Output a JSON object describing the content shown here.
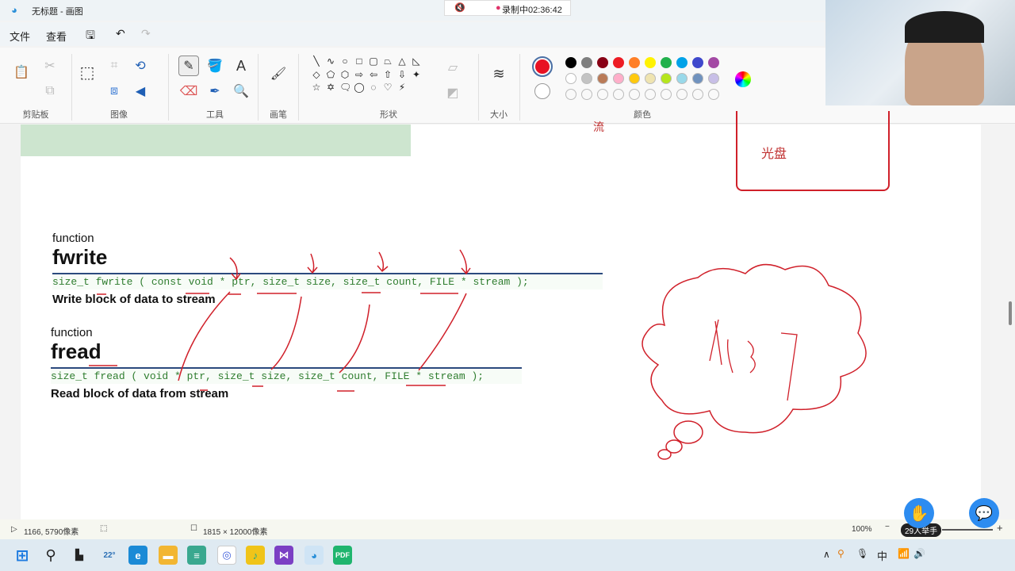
{
  "window": {
    "title": "无标题 - 画图"
  },
  "recording": {
    "label": "录制中02:36:42",
    "mute_icon": "speaker-muted-icon"
  },
  "menu": {
    "file": "文件",
    "view": "查看"
  },
  "ribbon": {
    "groups": [
      "剪贴板",
      "图像",
      "工具",
      "画笔",
      "形状",
      "大小",
      "颜色"
    ],
    "shapes": [
      "╲",
      "∿",
      "○",
      "□",
      "▢",
      "⏢",
      "△",
      "◺",
      "◇",
      "⬠",
      "⬡",
      "⇨",
      "⇦",
      "⇧",
      "⇩",
      "✦",
      "☆",
      "✡",
      "🗨",
      "◯",
      "◌",
      "♡",
      "⚡"
    ],
    "primary_color": "#e81123",
    "secondary_color": "#ffffff",
    "palette_row1": [
      "#000000",
      "#7f7f7f",
      "#880015",
      "#ed1c24",
      "#ff7f27",
      "#fff200",
      "#22b14c",
      "#00a2e8",
      "#3f48cc",
      "#a349a4"
    ],
    "palette_row2": [
      "#ffffff",
      "#c3c3c3",
      "#b97a57",
      "#ffaec9",
      "#ffc90e",
      "#efe4b0",
      "#b5e61d",
      "#99d9ea",
      "#7092be",
      "#c8bfe7"
    ]
  },
  "canvas": {
    "fwrite": {
      "kind": "function",
      "name": "fwrite",
      "prototype": "size_t fwrite ( const void * ptr, size_t size, size_t count, FILE * stream );",
      "description": "Write block of data to stream"
    },
    "fread": {
      "kind": "function",
      "name": "fread",
      "prototype": "size_t fread ( void * ptr, size_t size, size_t count, FILE * stream );",
      "description": "Read block of data from stream"
    },
    "box_text": "光盘",
    "partial_text": "流",
    "annotation_color": "#d0202a"
  },
  "status": {
    "cursor": "1166, 5790像素",
    "canvas_size": "1815 × 12000像素",
    "zoom": "100%",
    "raise_hand": "29人举手"
  },
  "taskbar": {
    "weather": "22°"
  }
}
